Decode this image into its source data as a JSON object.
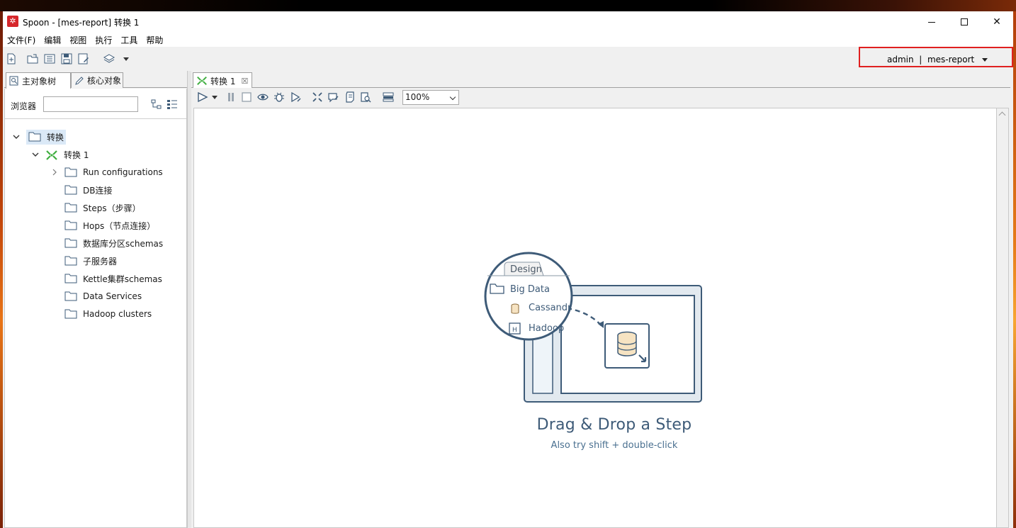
{
  "window": {
    "title": "Spoon - [mes-report] 转换 1"
  },
  "menu": {
    "items": [
      "文件(F)",
      "编辑",
      "视图",
      "执行",
      "工具",
      "帮助"
    ]
  },
  "toolbar": {
    "user": "admin",
    "separator": "|",
    "repository": "mes-report"
  },
  "left_panel": {
    "tabs": [
      "主对象树",
      "核心对象"
    ],
    "browser_label": "浏览器",
    "browser_value": "",
    "tree": {
      "root": "转换",
      "child": "转换 1",
      "folders": [
        "Run configurations",
        "DB连接",
        "Steps（步骤）",
        "Hops（节点连接）",
        "数据库分区schemas",
        "子服务器",
        "Kettle集群schemas",
        "Data Services",
        "Hadoop clusters"
      ]
    }
  },
  "editor": {
    "tab_label": "转换 1",
    "zoom": "100%",
    "empty_title": "Drag & Drop a Step",
    "empty_subtitle": "Also try shift + double-click",
    "illustration": {
      "tab": "Design",
      "folder": "Big Data",
      "items": [
        "Cassandr",
        "Hadoop"
      ]
    }
  },
  "colors": {
    "accent_red": "#e02020",
    "transform_icon": "#3fae3f",
    "illustration_stroke": "#3e5b78",
    "selected_row": "#dbe9f7"
  }
}
